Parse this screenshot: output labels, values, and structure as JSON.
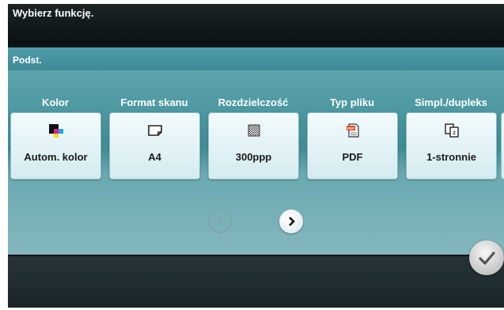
{
  "header": {
    "title": "Wybierz funkcję."
  },
  "tab": {
    "label": "Podst."
  },
  "functions": [
    {
      "title": "Kolor",
      "value": "Autom. kolor",
      "icon": "color-auto-icon"
    },
    {
      "title": "Format skanu",
      "value": "A4",
      "icon": "paper-size-icon"
    },
    {
      "title": "Rozdzielczość",
      "value": "300ppp",
      "icon": "resolution-icon"
    },
    {
      "title": "Typ pliku",
      "value": "PDF",
      "icon": "pdf-file-icon"
    },
    {
      "title": "Simpl./dupleks",
      "value": "1-stronnie",
      "icon": "simplex-duplex-icon"
    }
  ],
  "nav": {
    "prev_icon": "chevron-left-icon",
    "next_icon": "chevron-right-icon"
  },
  "ok": {
    "icon": "checkmark-icon"
  },
  "colors": {
    "accent": "#4f9ca8",
    "header_bg": "#121a1c",
    "button_bg": "#e6f4f7"
  }
}
